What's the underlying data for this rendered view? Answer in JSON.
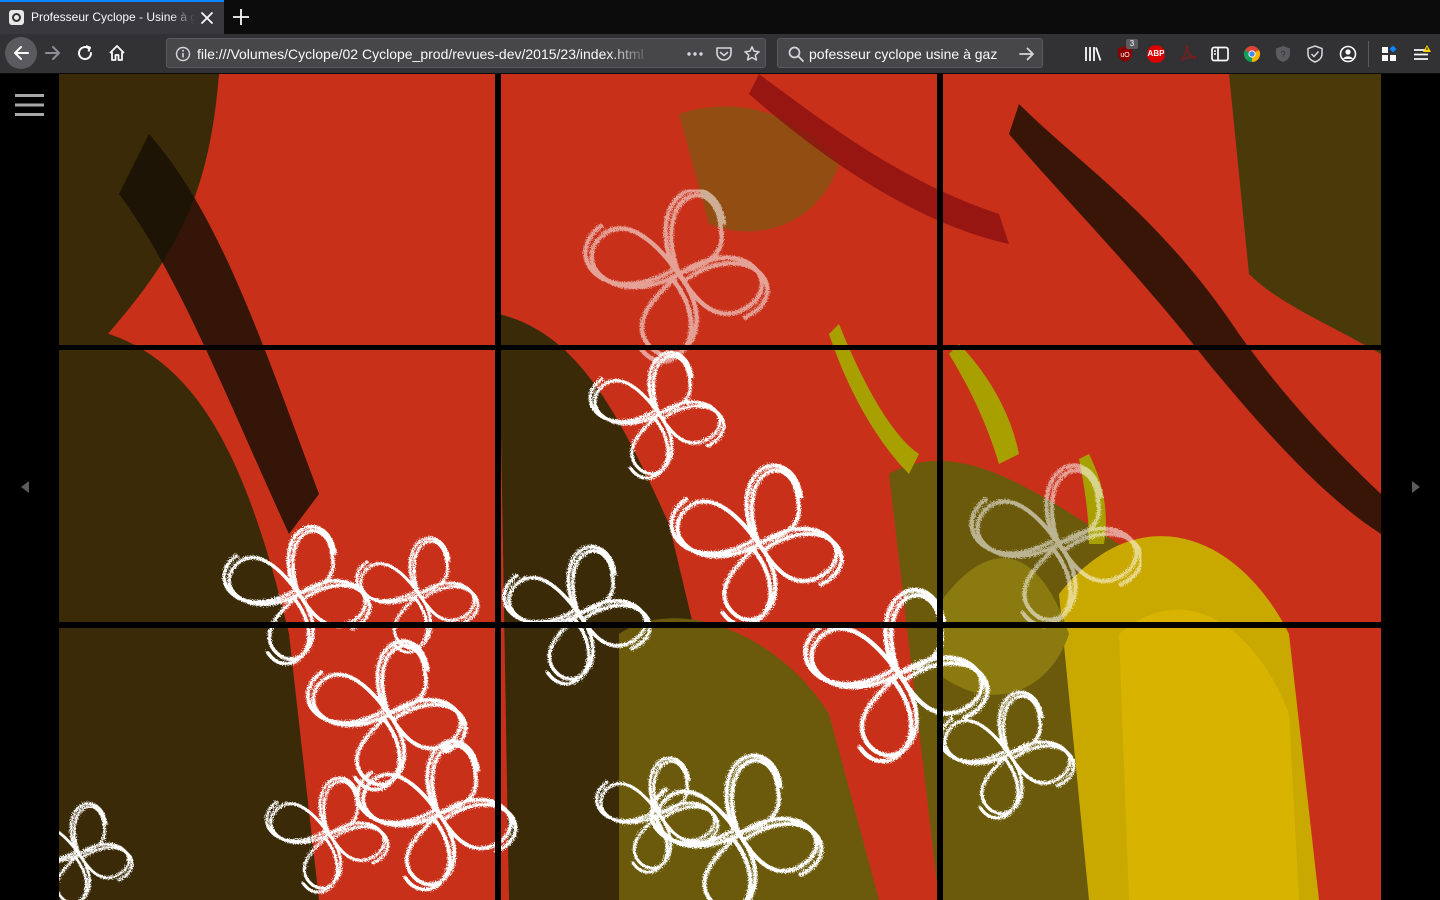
{
  "browser": {
    "tab": {
      "title": "Professeur Cyclope - Usine à gaz"
    },
    "url": "file:///Volumes/Cyclope/02 Cyclope_prod/revues-dev/2015/23/index.html",
    "search_query": "pofesseur cyclope usine à gaz",
    "toolbar_badge_count": "3",
    "adblock_label": "ABP",
    "accent_color": "#0a84ff",
    "icons": [
      "reload-icon",
      "home-icon",
      "info-icon",
      "page-actions-icon",
      "pocket-icon",
      "bookmark-star-icon",
      "search-icon",
      "go-arrow-icon",
      "library-icon",
      "ublock-icon",
      "adblock-plus-icon",
      "pdf-icon",
      "sidebar-icon",
      "chrome-icon",
      "privacy-badger-icon",
      "shield-icon",
      "account-icon",
      "extensions-icon",
      "menu-icon"
    ]
  },
  "page": {
    "background": "#000000",
    "artwork": {
      "grid_columns": 3,
      "grid_rows": 3,
      "palette": [
        "#c6301c",
        "#3a2a06",
        "#6b5a0c",
        "#c9a900",
        "#ffffff"
      ],
      "motif": "flowers"
    },
    "icons": [
      "hamburger-icon",
      "prev-arrow-icon",
      "next-arrow-icon"
    ]
  }
}
